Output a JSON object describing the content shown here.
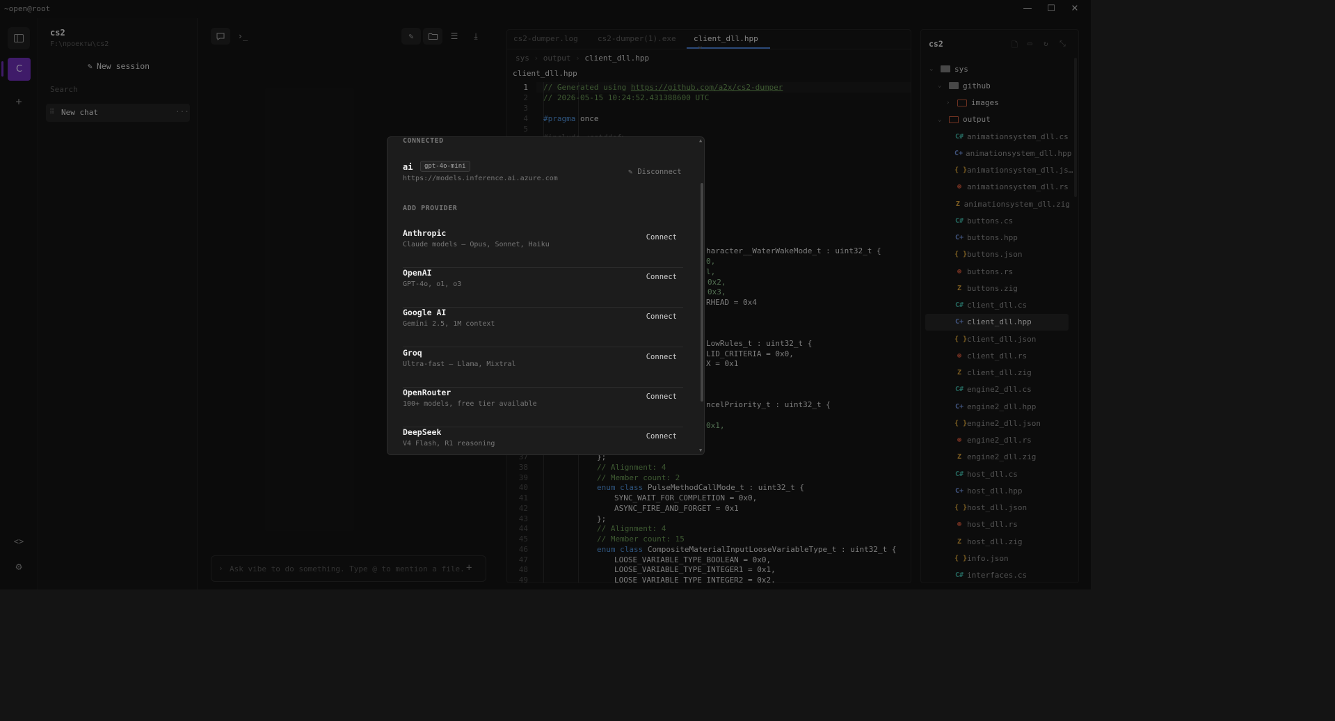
{
  "window": {
    "title": "~open@root"
  },
  "activity": {
    "avatar_letter": "C"
  },
  "sessions": {
    "project_name": "cs2",
    "project_path": "F:\\проекты\\cs2",
    "new_session_label": "New session",
    "search_placeholder": "Search",
    "chats": [
      {
        "label": "New chat"
      }
    ]
  },
  "chat": {
    "composer_placeholder": "Ask vibe to do something. Type @ to mention a file."
  },
  "editor": {
    "tabs": [
      {
        "label": "cs2-dumper.log"
      },
      {
        "label": "cs2-dumper(1).exe"
      },
      {
        "label": "client_dll.hpp"
      }
    ],
    "breadcrumb": [
      "sys",
      "output",
      "client_dll.hpp"
    ],
    "file_title": "client_dll.hpp",
    "code_visible": {
      "l1_comment": "// Generated using ",
      "l1_link": "https://github.com/a2x/cs2-dumper",
      "l2": "// 2026-05-15 10:24:52.431388600 UTC",
      "l4_kw": "#pragma",
      "l4_rest": " once",
      "l5": "#include <cstddef>",
      "frag1": "haracter__WaterWakeMode_t : uint32_t {",
      "frag2": "0,",
      "frag3": "l,",
      "frag4": "0x2,",
      "frag5": "0x3,",
      "frag6": "RHEAD = 0x4",
      "frag7": "LowRules_t : uint32_t {",
      "frag8": "LID_CRITERIA = 0x0,",
      "frag9": "X = 0x1",
      "frag10": "ncelPriority_t : uint32_t {",
      "frag11": "0x1,",
      "l37": "};",
      "l38": "// Alignment: 4",
      "l39": "// Member count: 2",
      "l40_kw": "enum class",
      "l40_rest": " PulseMethodCallMode_t : uint32_t {",
      "l41": "SYNC_WAIT_FOR_COMPLETION = 0x0,",
      "l42": "ASYNC_FIRE_AND_FORGET = 0x1",
      "l43": "};",
      "l44": "// Alignment: 4",
      "l45": "// Member count: 15",
      "l46_kw": "enum class",
      "l46_rest": " CompositeMaterialInputLooseVariableType_t : uint32_t {",
      "l47": "LOOSE_VARIABLE_TYPE_BOOLEAN = 0x0,",
      "l48": "LOOSE_VARIABLE_TYPE_INTEGER1 = 0x1,",
      "l49": "LOOSE_VARIABLE_TYPE_INTEGER2 = 0x2,"
    },
    "line_numbers_top": [
      "1",
      "2",
      "3",
      "4",
      "5"
    ],
    "line_numbers_bottom": [
      "37",
      "38",
      "39",
      "40",
      "41",
      "42",
      "43",
      "44",
      "45",
      "46",
      "47",
      "48",
      "49"
    ]
  },
  "explorer": {
    "root": "cs2",
    "tree": [
      {
        "label": "sys",
        "kind": "folder"
      },
      {
        "label": "github",
        "kind": "folder"
      },
      {
        "label": "images",
        "kind": "folder"
      },
      {
        "label": "output",
        "kind": "folder"
      },
      {
        "label": "animationsystem_dll.cs",
        "icon": "C#"
      },
      {
        "label": "animationsystem_dll.hpp",
        "icon": "C++"
      },
      {
        "label": "animationsystem_dll.js…",
        "icon": "{}"
      },
      {
        "label": "animationsystem_dll.rs",
        "icon": "rs"
      },
      {
        "label": "animationsystem_dll.zig",
        "icon": "zig"
      },
      {
        "label": "buttons.cs",
        "icon": "C#"
      },
      {
        "label": "buttons.hpp",
        "icon": "C++"
      },
      {
        "label": "buttons.json",
        "icon": "{}"
      },
      {
        "label": "buttons.rs",
        "icon": "rs"
      },
      {
        "label": "buttons.zig",
        "icon": "zig"
      },
      {
        "label": "client_dll.cs",
        "icon": "C#"
      },
      {
        "label": "client_dll.hpp",
        "icon": "C++",
        "selected": true
      },
      {
        "label": "client_dll.json",
        "icon": "{}"
      },
      {
        "label": "client_dll.rs",
        "icon": "rs"
      },
      {
        "label": "client_dll.zig",
        "icon": "zig"
      },
      {
        "label": "engine2_dll.cs",
        "icon": "C#"
      },
      {
        "label": "engine2_dll.hpp",
        "icon": "C++"
      },
      {
        "label": "engine2_dll.json",
        "icon": "{}"
      },
      {
        "label": "engine2_dll.rs",
        "icon": "rs"
      },
      {
        "label": "engine2_dll.zig",
        "icon": "zig"
      },
      {
        "label": "host_dll.cs",
        "icon": "C#"
      },
      {
        "label": "host_dll.hpp",
        "icon": "C++"
      },
      {
        "label": "host_dll.json",
        "icon": "{}"
      },
      {
        "label": "host_dll.rs",
        "icon": "rs"
      },
      {
        "label": "host_dll.zig",
        "icon": "zig"
      },
      {
        "label": "info.json",
        "icon": "{}"
      },
      {
        "label": "interfaces.cs",
        "icon": "C#"
      }
    ]
  },
  "modal": {
    "connected_heading": "CONNECTED",
    "connected": {
      "name": "ai",
      "model": "gpt-4o-mini",
      "url": "https://models.inference.ai.azure.com",
      "disconnect_label": "Disconnect"
    },
    "add_heading": "ADD PROVIDER",
    "providers": [
      {
        "name": "Anthropic",
        "desc": "Claude models — Opus, Sonnet, Haiku",
        "action": "Connect"
      },
      {
        "name": "OpenAI",
        "desc": "GPT-4o, o1, o3",
        "action": "Connect"
      },
      {
        "name": "Google AI",
        "desc": "Gemini 2.5, 1M context",
        "action": "Connect"
      },
      {
        "name": "Groq",
        "desc": "Ultra-fast — Llama, Mixtral",
        "action": "Connect"
      },
      {
        "name": "OpenRouter",
        "desc": "100+ models, free tier available",
        "action": "Connect"
      },
      {
        "name": "DeepSeek",
        "desc": "V4 Flash, R1 reasoning",
        "action": "Connect"
      }
    ]
  },
  "colors": {
    "accent": "#6d2fb5",
    "tab_underline": "#4a7fd0",
    "background": "#141414",
    "modal_bg": "#1c1c1c",
    "icon_csharp": "#3fb0a0",
    "icon_cpp": "#6f8fd8",
    "icon_json": "#d4a13a",
    "icon_rust": "#d0563a",
    "icon_zig": "#d8a03a"
  }
}
